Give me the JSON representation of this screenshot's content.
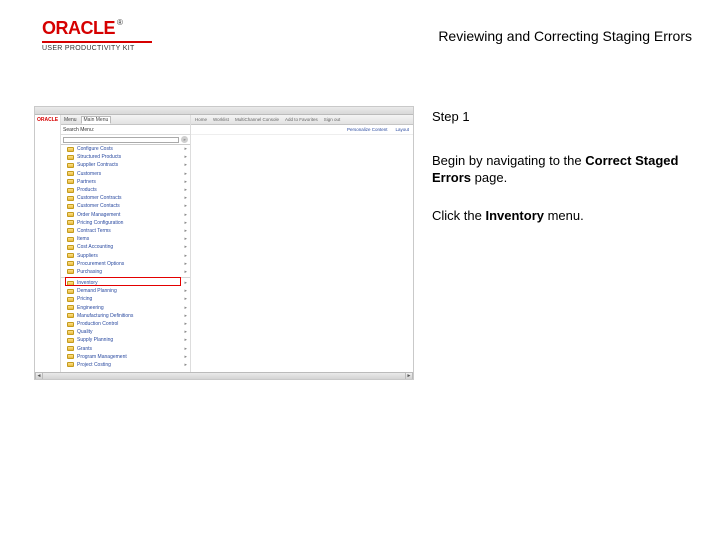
{
  "header": {
    "brand": "ORACLE",
    "brand_sub": "USER PRODUCTIVITY KIT",
    "title": "Reviewing and Correcting Staging Errors"
  },
  "instructions": {
    "step_label": "Step 1",
    "para1_a": "Begin by navigating to the ",
    "para1_b": "Correct Staged Errors",
    "para1_c": " page.",
    "para2_a": "Click the ",
    "para2_b": "Inventory",
    "para2_c": " menu."
  },
  "screenshot": {
    "left_tab": "Menu",
    "main_menu_label": "Main Menu",
    "search_label": "Search Menu:",
    "search_go": "»",
    "right_tabs": [
      "Home",
      "Worklist",
      "MultiChannel Console",
      "Add to Favorites",
      "Sign out"
    ],
    "right_links": [
      "Personalize Content",
      "Layout"
    ],
    "mini_logo": "ORACLE",
    "tree_top": [
      "Configure Costs",
      "Structured Products",
      "Supplier Contracts",
      "Customers",
      "Partners",
      "Products",
      "Customer Contracts",
      "Customer Contacts",
      "Order Management",
      "Pricing Configuration",
      "Contract Terms",
      "Items",
      "Cost Accounting",
      "Suppliers",
      "Procurement Options",
      "Purchasing"
    ],
    "tree_bottom": [
      "Inventory",
      "Demand Planning",
      "Pricing",
      "Engineering",
      "Manufacturing Definitions",
      "Production Control",
      "Quality",
      "Supply Planning",
      "Grants",
      "Program Management",
      "Project Costing"
    ],
    "highlight_index": 0
  }
}
